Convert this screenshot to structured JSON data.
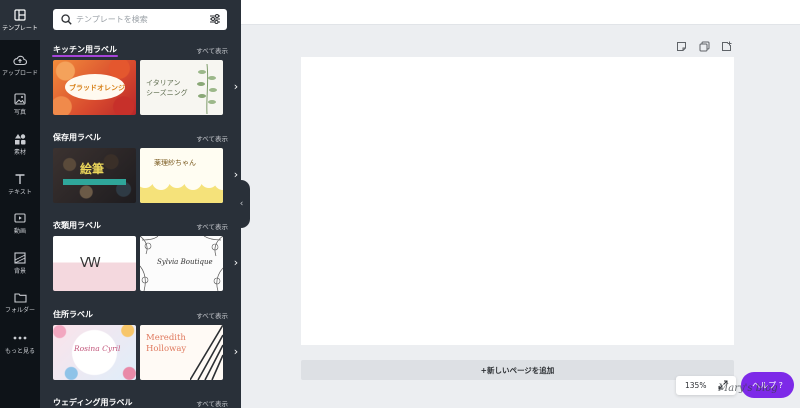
{
  "sidebar": {
    "items": [
      {
        "label": "テンプレート",
        "icon": "template-icon",
        "active": true
      },
      {
        "label": "アップロード",
        "icon": "upload-cloud-icon",
        "active": false
      },
      {
        "label": "写真",
        "icon": "photo-icon",
        "active": false
      },
      {
        "label": "素材",
        "icon": "elements-icon",
        "active": false
      },
      {
        "label": "テキスト",
        "icon": "text-icon",
        "active": false
      },
      {
        "label": "動画",
        "icon": "video-icon",
        "active": false
      },
      {
        "label": "背景",
        "icon": "background-icon",
        "active": false
      },
      {
        "label": "フォルダー",
        "icon": "folder-icon",
        "active": false
      },
      {
        "label": "もっと見る",
        "icon": "more-icon",
        "active": false
      }
    ]
  },
  "panel": {
    "search": {
      "placeholder": "テンプレートを検索",
      "value": ""
    },
    "see_all_label": "すべて表示",
    "sections": [
      {
        "title": "キッチン用ラベル",
        "thumbs": [
          {
            "text": "ブラッドオレンジ"
          },
          {
            "text_line1": "イタリアン",
            "text_line2": "シーズニング"
          }
        ]
      },
      {
        "title": "保存用ラベル",
        "thumbs": [
          {
            "text": "絵筆"
          },
          {
            "text": "薬理紗ちゃん"
          }
        ]
      },
      {
        "title": "衣類用ラベル",
        "thumbs": [
          {
            "text": "VW"
          },
          {
            "text": "Sylvia Boutique"
          }
        ]
      },
      {
        "title": "住所ラベル",
        "thumbs": [
          {
            "text": "Rosina Cyril"
          },
          {
            "text_line1": "Meredith",
            "text_line2": "Holloway"
          }
        ]
      },
      {
        "title": "ウェディング用ラベル",
        "thumbs": []
      }
    ]
  },
  "canvas": {
    "add_page_label": "+新しいページを追加",
    "zoom_label": "135%",
    "help_label": "ヘルプ ?",
    "watermark": "Mary's blog"
  },
  "colors": {
    "accent": "#7d2ae8",
    "panel": "#293039",
    "rail": "#0e1318",
    "underline": "#a544d9"
  }
}
